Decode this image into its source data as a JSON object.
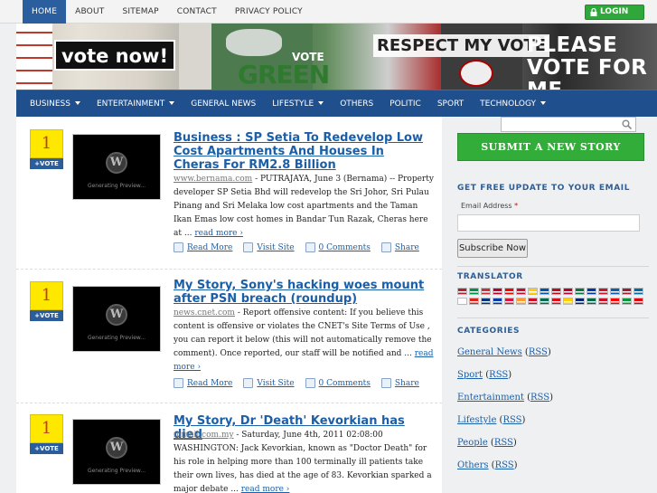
{
  "topnav": {
    "items": [
      "HOME",
      "ABOUT",
      "SITEMAP",
      "CONTACT",
      "PRIVACY POLICY"
    ],
    "login": "LOGIN"
  },
  "banner": {
    "vote_now": "vote now!",
    "green": "GREEN",
    "vote": "VOTE",
    "respect": "RESPECT MY VOTE",
    "please": "PLEASE VOTE FOR ME"
  },
  "mainnav": {
    "items": [
      {
        "label": "BUSINESS",
        "dropdown": true
      },
      {
        "label": "ENTERTAINMENT",
        "dropdown": true
      },
      {
        "label": "GENERAL NEWS",
        "dropdown": false
      },
      {
        "label": "LIFESTYLE",
        "dropdown": true
      },
      {
        "label": "OTHERS",
        "dropdown": false
      },
      {
        "label": "POLITIC",
        "dropdown": false
      },
      {
        "label": "SPORT",
        "dropdown": false
      },
      {
        "label": "TECHNOLOGY",
        "dropdown": true
      }
    ]
  },
  "posts": [
    {
      "votes": "1",
      "vote_label": "+VOTE",
      "thumb_text": "Generating Preview...",
      "title": "Business : SP Setia To Redevelop Low Cost Apartments And Houses In Cheras For RM2.8 Billion",
      "source": "www.bernama.com",
      "excerpt": " - PUTRAJAYA, June 3 (Bernama) -- Property developer SP Setia Bhd will redevelop the Sri Johor, Sri Pulau Pinang and Sri Melaka low cost apartments and the Taman Ikan Emas low cost homes in Bandar Tun Razak, Cheras here at ...",
      "more": "read more ›"
    },
    {
      "votes": "1",
      "vote_label": "+VOTE",
      "thumb_text": "Generating Preview...",
      "title": "My Story, Sony's hacking woes mount after PSN breach (roundup)",
      "source": "news.cnet.com",
      "excerpt": " - Report offensive content: If you believe this content is offensive or violates the CNET's Site Terms of Use , you can report it below (this will not automatically remove the comment). Once reported, our staff will be notified and ...",
      "more": "read more ›"
    },
    {
      "votes": "1",
      "vote_label": "+VOTE",
      "thumb_text": "Generating Preview...",
      "title": "My Story, Dr 'Death' Kevorkian has died",
      "source": "mmail.com.my",
      "excerpt": " - Saturday, June 4th, 2011 02:08:00 WASHINGTON: Jack Kevorkian, known as \"Doctor Death\" for his role in helping more than 100 terminally ill patients take their own lives, has died at the age of 83. Kevorkian sparked a major debate ...",
      "more": "read more ›"
    }
  ],
  "actions": [
    "Read More",
    "Visit Site",
    "0 Comments",
    "Share"
  ],
  "sidebar": {
    "submit_story": "SUBMIT A NEW STORY",
    "update_heading": "GET FREE UPDATE TO YOUR EMAIL",
    "email_label": "Email Address",
    "email_required": "*",
    "subscribe": "Subscribe Now",
    "translator_heading": "TRANSLATOR",
    "categories_heading": "CATEGORIES",
    "categories": [
      {
        "name": "General News",
        "rss": "RSS"
      },
      {
        "name": "Sport",
        "rss": "RSS"
      },
      {
        "name": "Entertainment",
        "rss": "RSS"
      },
      {
        "name": "Lifestyle",
        "rss": "RSS"
      },
      {
        "name": "People",
        "rss": "RSS"
      },
      {
        "name": "Others",
        "rss": "RSS"
      }
    ],
    "flag_colors": [
      "#b22234",
      "#009246",
      "#cd2e3a",
      "#bc002d",
      "#fe0000",
      "#c60c30",
      "#ffce00",
      "#0055a4",
      "#c60b1e",
      "#bc002d",
      "#007a3d",
      "#0039a6",
      "#cf142b",
      "#0d5eaf",
      "#a51931",
      "#006aa7",
      "#ffffff",
      "#da251d",
      "#003580",
      "#0038a8",
      "#dc143c",
      "#ff9933",
      "#ce1126",
      "#006a4e",
      "#e30a17",
      "#ffcd00",
      "#00247d",
      "#006847",
      "#ce1126",
      "#fe0000",
      "#009739",
      "#da0010"
    ]
  }
}
